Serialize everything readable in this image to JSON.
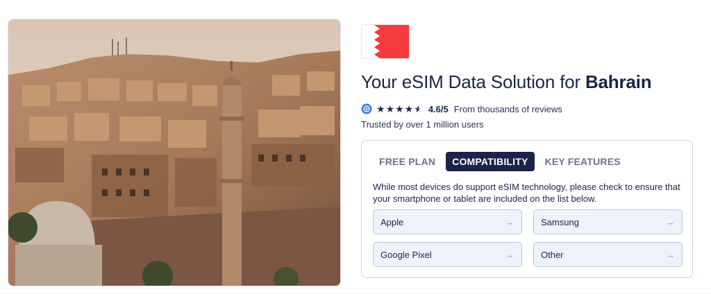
{
  "hero": {
    "image_alt": ""
  },
  "flag": {
    "colors": {
      "white": "#ffffff",
      "red": "#f53b3e"
    }
  },
  "headline": {
    "prefix": "Your eSIM Data Solution for ",
    "country": "Bahrain"
  },
  "rating": {
    "badge_icon": "globe-badge-icon",
    "stars_full": 4,
    "stars_half": 1,
    "score": "4.6/5",
    "reviews_text": "From thousands of reviews"
  },
  "trusted_text": "Trusted by over 1 million users",
  "tabs": [
    {
      "label": "FREE PLAN",
      "active": false
    },
    {
      "label": "COMPATIBILITY",
      "active": true
    },
    {
      "label": "KEY FEATURES",
      "active": false
    }
  ],
  "compatibility": {
    "description": "While most devices do support eSIM technology, please check to ensure that your smartphone or tablet are included on the list below.",
    "devices": [
      {
        "label": "Apple",
        "arrow": "→"
      },
      {
        "label": "Samsung",
        "arrow": "→"
      },
      {
        "label": "Google Pixel",
        "arrow": "→"
      },
      {
        "label": "Other",
        "arrow": "→"
      }
    ]
  },
  "colors": {
    "navy": "#1c2348",
    "card_border": "#c8d3ea",
    "device_bg": "#eef2fb"
  }
}
